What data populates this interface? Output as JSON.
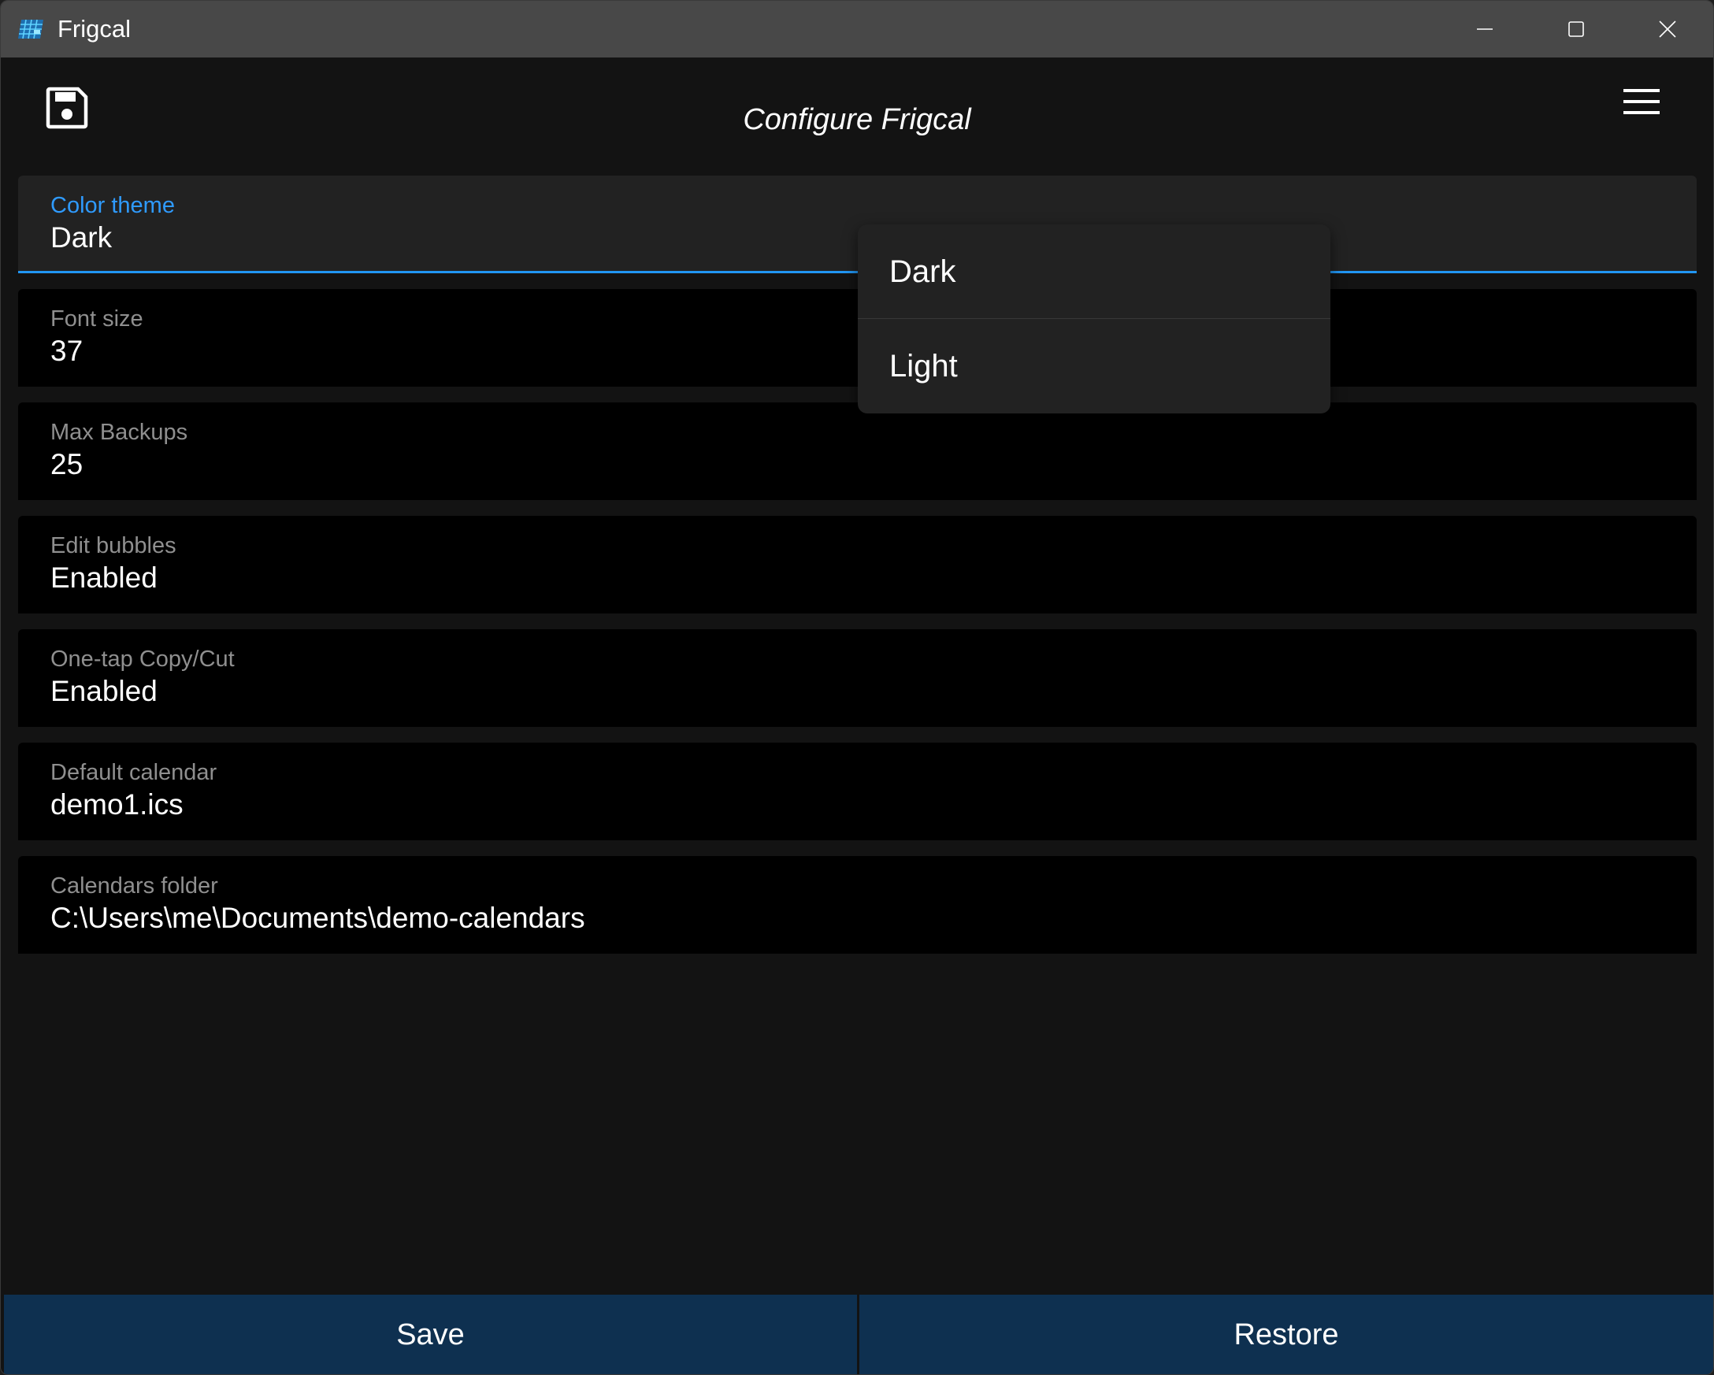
{
  "window": {
    "title": "Frigcal",
    "icon": "calendar-grid-icon",
    "controls": [
      "minimize-icon",
      "maximize-icon",
      "close-icon"
    ]
  },
  "header": {
    "title": "Configure Frigcal",
    "save_icon": "floppy-disk-icon",
    "menu_icon": "hamburger-menu-icon"
  },
  "settings": [
    {
      "label": "Color theme",
      "value": "Dark",
      "active": true
    },
    {
      "label": "Font size",
      "value": "37"
    },
    {
      "label": "Max Backups",
      "value": "25"
    },
    {
      "label": "Edit bubbles",
      "value": "Enabled"
    },
    {
      "label": "One-tap Copy/Cut",
      "value": "Enabled"
    },
    {
      "label": "Default calendar",
      "value": "demo1.ics"
    },
    {
      "label": "Calendars folder",
      "value": "C:\\Users\\me\\Documents\\demo-calendars"
    }
  ],
  "dropdown": {
    "options": [
      "Dark",
      "Light"
    ]
  },
  "footer": {
    "save_label": "Save",
    "restore_label": "Restore"
  },
  "colors": {
    "background": "#131313",
    "accent": "#2196f3",
    "button_bg": "#0e3050",
    "titlebar": "#484848"
  }
}
